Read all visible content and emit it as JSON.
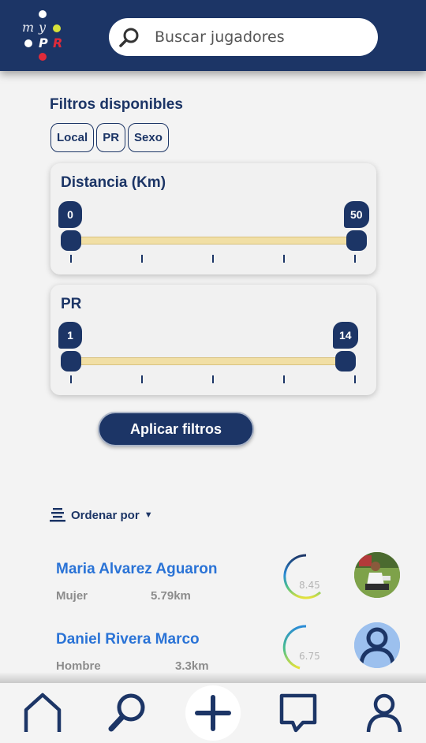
{
  "logo": {
    "letters": [
      "m",
      "y",
      "P",
      "R"
    ]
  },
  "search": {
    "placeholder": "Buscar jugadores",
    "icon": "search-icon"
  },
  "filters": {
    "title": "Filtros disponibles",
    "chips": [
      "Local",
      "PR",
      "Sexo"
    ]
  },
  "sliders": {
    "distance": {
      "title": "Distancia (Km)",
      "min": "0",
      "max": "50",
      "low": 0,
      "high": 50
    },
    "pr": {
      "title": "PR",
      "min": "1",
      "max": "14",
      "low": 1,
      "high": 14
    }
  },
  "apply_label": "Aplicar filtros",
  "sort": {
    "label": "Ordenar por",
    "caret": "▼"
  },
  "players": [
    {
      "name": "Maria Alvarez Aguaron",
      "gender": "Mujer",
      "distance": "5.79km",
      "score": "8.45"
    },
    {
      "name": "Daniel Rivera Marco",
      "gender": "Hombre",
      "distance": "3.3km",
      "score": "6.75"
    }
  ],
  "nav": [
    "home-icon",
    "search-icon",
    "add-icon",
    "messages-icon",
    "profile-icon"
  ],
  "colors": {
    "primary": "#1c3566",
    "accent_blue": "#2a73d6",
    "track": "#f1dfa5",
    "logo_yellow": "#d7e23a",
    "logo_red": "#e02b3a"
  }
}
